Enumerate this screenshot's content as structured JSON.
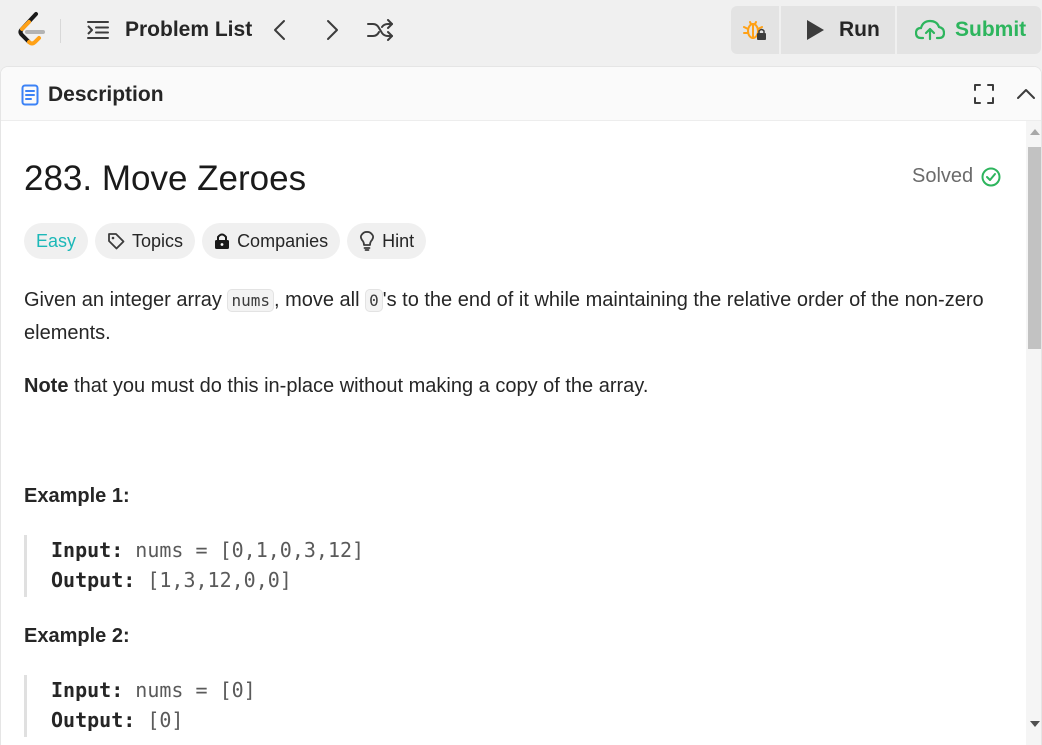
{
  "topbar": {
    "problem_list_label": "Problem List",
    "run_label": "Run",
    "submit_label": "Submit",
    "icons": {
      "logo": "leetcode-logo",
      "list": "list-icon",
      "prev": "chevron-left-icon",
      "next": "chevron-right-icon",
      "shuffle": "shuffle-icon",
      "debug": "bug-lock-icon",
      "run": "play-icon",
      "submit": "cloud-upload-icon"
    }
  },
  "panel": {
    "tab_label": "Description",
    "icons": {
      "tab": "description-icon",
      "maximize": "maximize-icon",
      "collapse": "chevron-up-icon"
    }
  },
  "problem": {
    "title": "283. Move Zeroes",
    "status": "Solved",
    "tags": {
      "difficulty": "Easy",
      "topics": "Topics",
      "companies": "Companies",
      "hint": "Hint"
    },
    "description": {
      "p1_a": "Given an integer array ",
      "p1_code1": "nums",
      "p1_b": ", move all ",
      "p1_code2": "0",
      "p1_c": "'s to the end of it while maintaining the relative order of the non-zero elements.",
      "p2_bold": "Note",
      "p2_rest": " that you must do this in-place without making a copy of the array."
    },
    "examples": [
      {
        "title": "Example 1:",
        "input_key": "Input:",
        "input_val": "nums = [0,1,0,3,12]",
        "output_key": "Output:",
        "output_val": "[1,3,12,0,0]"
      },
      {
        "title": "Example 2:",
        "input_key": "Input:",
        "input_val": "nums = [0]",
        "output_key": "Output:",
        "output_val": "[0]"
      }
    ]
  },
  "colors": {
    "accent_green": "#2db55d",
    "easy_teal": "#1cb8b8",
    "logo_orange": "#ffa116"
  }
}
